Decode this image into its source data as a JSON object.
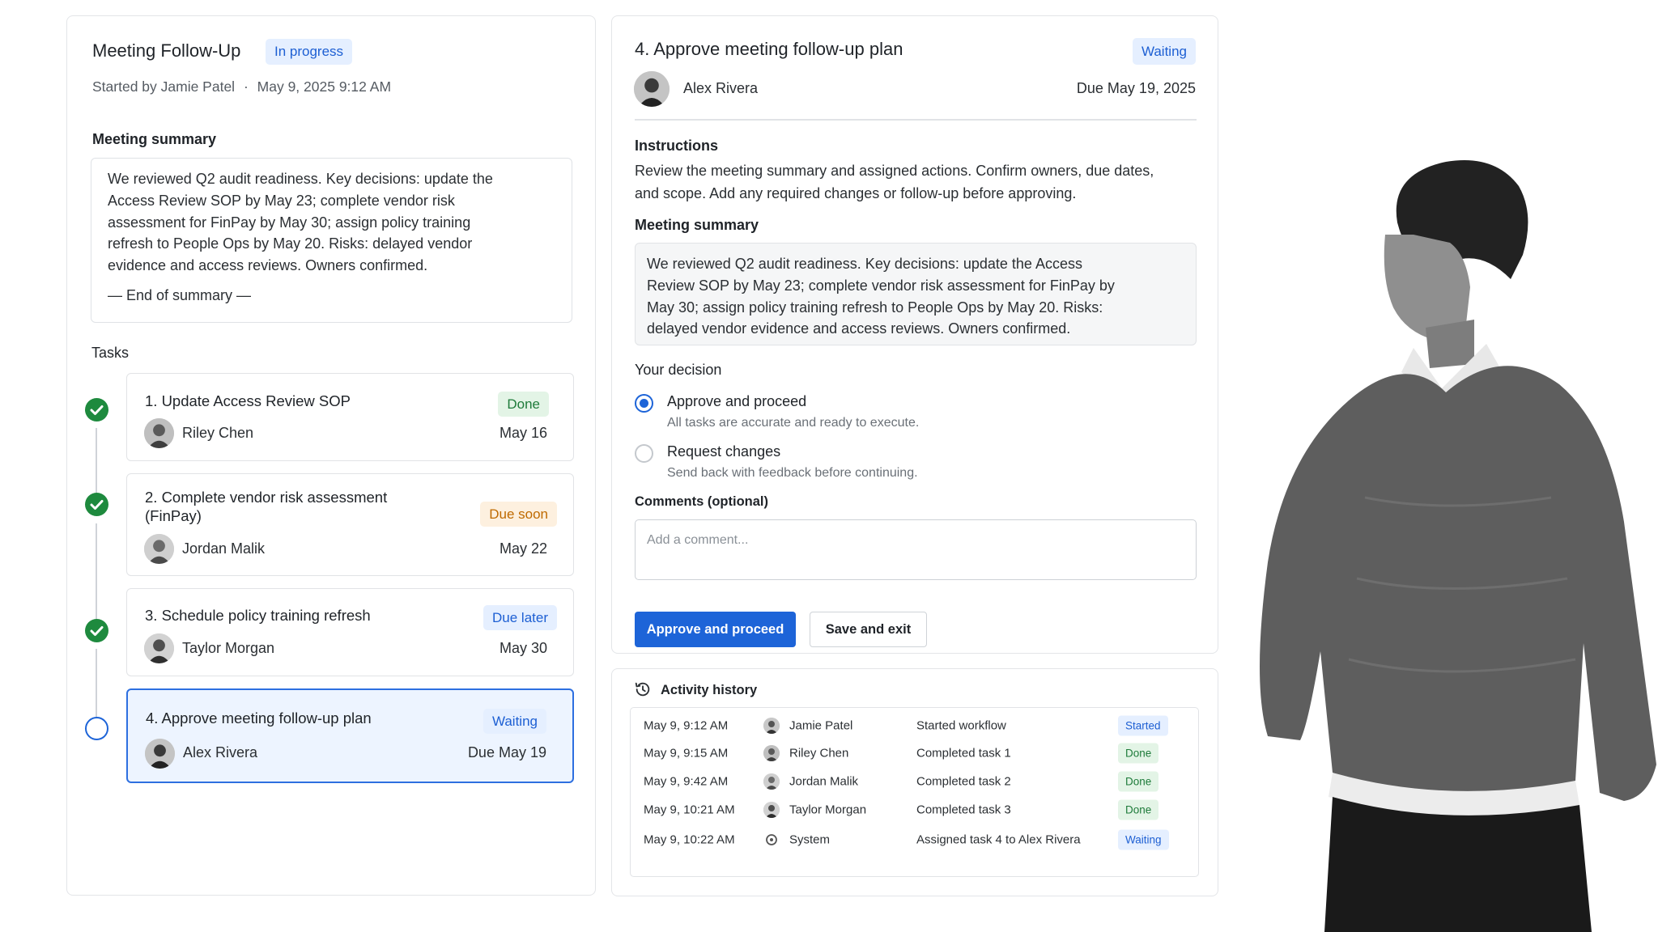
{
  "workflow": {
    "title": "Meeting Follow-Up",
    "status": "In progress",
    "started_by": "Started by Jamie Patel",
    "separator": "·",
    "started_at": "May 9, 2025 9:12 AM",
    "summary_label": "Meeting summary",
    "summary_text": "We reviewed Q2 audit readiness. Key decisions: update the Access Review SOP by May 23; complete vendor risk assessment for FinPay by May 30; assign policy training refresh to People Ops by May 20. Risks: delayed vendor evidence and access reviews. Owners confirmed.",
    "summary_end": "— End of summary —",
    "tasks_label": "Tasks",
    "tasks": [
      {
        "title": "1. Update Access Review SOP",
        "owner": "Riley Chen",
        "date": "May 16",
        "badge": "Done",
        "step": "done"
      },
      {
        "title": "2. Complete vendor risk assessment (FinPay)",
        "owner": "Jordan Malik",
        "date": "May 22",
        "badge": "Due soon",
        "step": "done"
      },
      {
        "title": "3. Schedule policy training refresh",
        "owner": "Taylor Morgan",
        "date": "May 30",
        "badge": "Due later",
        "step": "done"
      },
      {
        "title": "4. Approve meeting follow-up plan",
        "owner": "Alex Rivera",
        "date": "Due May 19",
        "badge": "Waiting",
        "step": "current"
      }
    ]
  },
  "task_detail": {
    "title": "4. Approve meeting follow-up plan",
    "status": "Waiting",
    "assignee": "Alex Rivera",
    "due": "Due May 19, 2025",
    "instructions_label": "Instructions",
    "instructions_text": "Review the meeting summary and assigned actions. Confirm owners, due dates, and scope. Add any required changes or follow-up before approving.",
    "summary_label": "Meeting summary",
    "summary_text": "We reviewed Q2 audit readiness. Key decisions: update the Access Review SOP by May 23; complete vendor risk assessment for FinPay by May 30; assign policy training refresh to People Ops by May 20. Risks: delayed vendor evidence and access reviews. Owners confirmed.",
    "decision_label": "Your decision",
    "options": [
      {
        "label": "Approve and proceed",
        "hint": "All tasks are accurate and ready to execute.",
        "selected": true
      },
      {
        "label": "Request changes",
        "hint": "Send back with feedback before continuing.",
        "selected": false
      }
    ],
    "comments_label": "Comments (optional)",
    "comments_placeholder": "Add a comment...",
    "primary_button": "Approve and proceed",
    "secondary_button": "Save and exit"
  },
  "activity": {
    "title": "Activity history",
    "rows": [
      {
        "time": "May 9, 9:12 AM",
        "actor": "Jamie Patel",
        "action": "Started workflow",
        "badge": "Started"
      },
      {
        "time": "May 9, 9:15 AM",
        "actor": "Riley Chen",
        "action": "Completed task 1",
        "badge": "Done"
      },
      {
        "time": "May 9, 9:42 AM",
        "actor": "Jordan Malik",
        "action": "Completed task 2",
        "badge": "Done"
      },
      {
        "time": "May 9, 10:21 AM",
        "actor": "Taylor Morgan",
        "action": "Completed task 3",
        "badge": "Done"
      },
      {
        "time": "May 9, 10:22 AM",
        "actor": "System",
        "action": "Assigned task 4 to Alex Rivera",
        "badge": "Waiting"
      }
    ]
  },
  "colors": {
    "accent": "#1d64d8",
    "done_green": "#1e8a3e",
    "badge_blue_bg": "#e5efff",
    "badge_green_bg": "#e3f4e6",
    "badge_orange_bg": "#fdf0df",
    "active_card_bg": "#edf4ff"
  },
  "icons": [
    "check-icon",
    "history-icon",
    "system-icon",
    "avatar-icon"
  ]
}
